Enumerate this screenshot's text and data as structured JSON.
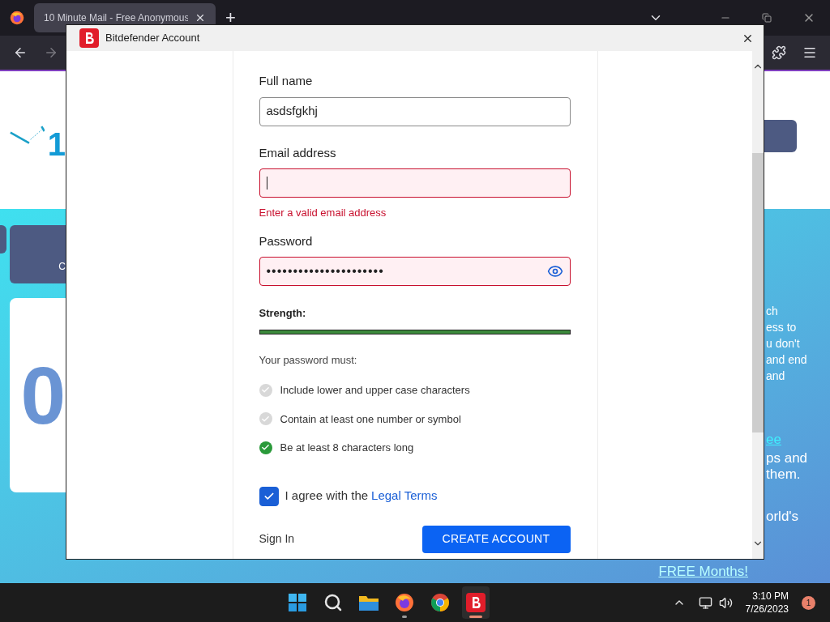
{
  "browser": {
    "tab": {
      "title": "10 Minute Mail - Free Anonymous",
      "selected": true
    },
    "new_tab": "+"
  },
  "background_page": {
    "logo_digit": "1",
    "left_card_text": "C",
    "counter_digit": "0",
    "paragraph_lines": [
      "ch",
      "ess to",
      "u don't",
      "and end",
      "and"
    ],
    "link": "ee",
    "lines": [
      "ps and",
      "them.",
      "orld's"
    ],
    "bottom_link": "FREE Months!"
  },
  "dialog": {
    "title": "Bitdefender Account",
    "fields": [
      {
        "label": "Full name",
        "value": "asdsfgkhj",
        "kind": "text",
        "invalid": false
      },
      {
        "label": "Email address",
        "kind": "text",
        "invalid": true,
        "error": "Enter a valid email address"
      },
      {
        "label": "Password",
        "value": "••••••••••••••••••••••",
        "kind": "password",
        "invalid": true
      }
    ],
    "strength": {
      "label": "Strength:",
      "level": 1
    },
    "rules_title": "Your password must:",
    "rules": [
      {
        "text": "Include lower and upper case characters",
        "checked": false
      },
      {
        "text": "Contain at least one number or symbol",
        "checked": false
      },
      {
        "text": "Be at least 8 characters long",
        "checked": true
      }
    ],
    "agree": {
      "checked": true,
      "text": "I agree with the",
      "link": "Legal Terms"
    },
    "sign_in": "Sign In",
    "create_button": "CREATE ACCOUNT"
  },
  "taskbar": {
    "apps": [
      {
        "kind": "start",
        "active": false
      },
      {
        "kind": "search",
        "active": false
      },
      {
        "kind": "folder",
        "active": false
      },
      {
        "kind": "firefox",
        "running": true,
        "active": false
      },
      {
        "kind": "chrome",
        "active": false
      },
      {
        "kind": "bitdefender",
        "running": true,
        "active": true
      }
    ],
    "time": "3:10 PM",
    "date": "7/26/2023",
    "notification_count": "1"
  }
}
